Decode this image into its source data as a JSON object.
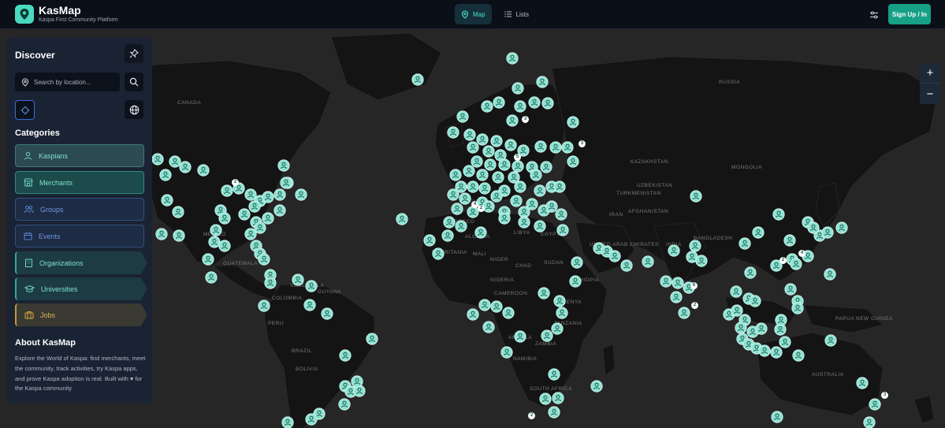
{
  "app": {
    "title": "KasMap",
    "subtitle": "Kaspa First Community Platform"
  },
  "nav": {
    "tabs": [
      {
        "label": "Map",
        "icon": "map-pin-icon",
        "active": true
      },
      {
        "label": "Lists",
        "icon": "list-icon",
        "active": false
      }
    ],
    "signup_label": "Sign Up / In"
  },
  "map_controls": {
    "zoom_in": "+",
    "zoom_out": "−"
  },
  "sidebar": {
    "title": "Discover",
    "search_placeholder": "Search by location...",
    "categories_title": "Categories",
    "categories": [
      {
        "label": "Kaspians",
        "icon": "person-icon",
        "color": "#6fd6c0"
      },
      {
        "label": "Merchants",
        "icon": "store-icon",
        "color": "#6fd6c0"
      },
      {
        "label": "Groups",
        "icon": "group-icon",
        "color": "#5b86d6"
      },
      {
        "label": "Events",
        "icon": "calendar-icon",
        "color": "#5b86d6"
      },
      {
        "label": "Organizations",
        "icon": "building-icon",
        "color": "#6fd6c0"
      },
      {
        "label": "Universities",
        "icon": "graduation-cap-icon",
        "color": "#6fd6c0"
      },
      {
        "label": "Jobs",
        "icon": "briefcase-icon",
        "color": "#d9a93c"
      }
    ],
    "about_title": "About KasMap",
    "about_text": "Explore the World of Kaspa: find merchants, meet the community, track activities, try Kaspa apps, and prove Kaspa adoption is real. Built with ♥ for the Kaspa community"
  },
  "map_labels": [
    "CANADA",
    "RUSSIA",
    "KAZAKHSTAN",
    "MONGOLIA",
    "UZBEKISTAN",
    "TURKMENISTAN",
    "AFGHANISTAN",
    "IRAN",
    "LIBYA",
    "EGYPT",
    "ALGERIA",
    "MOROCCO",
    "MAURITANIA",
    "MALI",
    "NIGER",
    "CHAD",
    "SUDAN",
    "ETHIOPIA",
    "KENYA",
    "TANZANIA",
    "ANGOLA",
    "ZAMBIA",
    "NAMIBIA",
    "SOUTH AFRICA",
    "NIGERIA",
    "CAMEROON",
    "BANGLADESH",
    "BRAZIL",
    "BOLIVIA",
    "PERU",
    "VENEZUELA",
    "COLOMBIA",
    "GUYANA",
    "AUSTRALIA",
    "PAPUA NEW GUINEA",
    "MEXICO",
    "GUATEMALA",
    "UNITED ARAB EMIRATES",
    "INDIA"
  ],
  "pin_clusters": [
    "2",
    "3",
    "4",
    "2",
    "5",
    "3",
    "2",
    "4",
    "6",
    "2",
    "3",
    "2"
  ],
  "colors": {
    "accent": "#16a085",
    "pin": "#8fe3d3",
    "panel": "#1a2333",
    "land": "#161616",
    "ocean": "#262626"
  }
}
